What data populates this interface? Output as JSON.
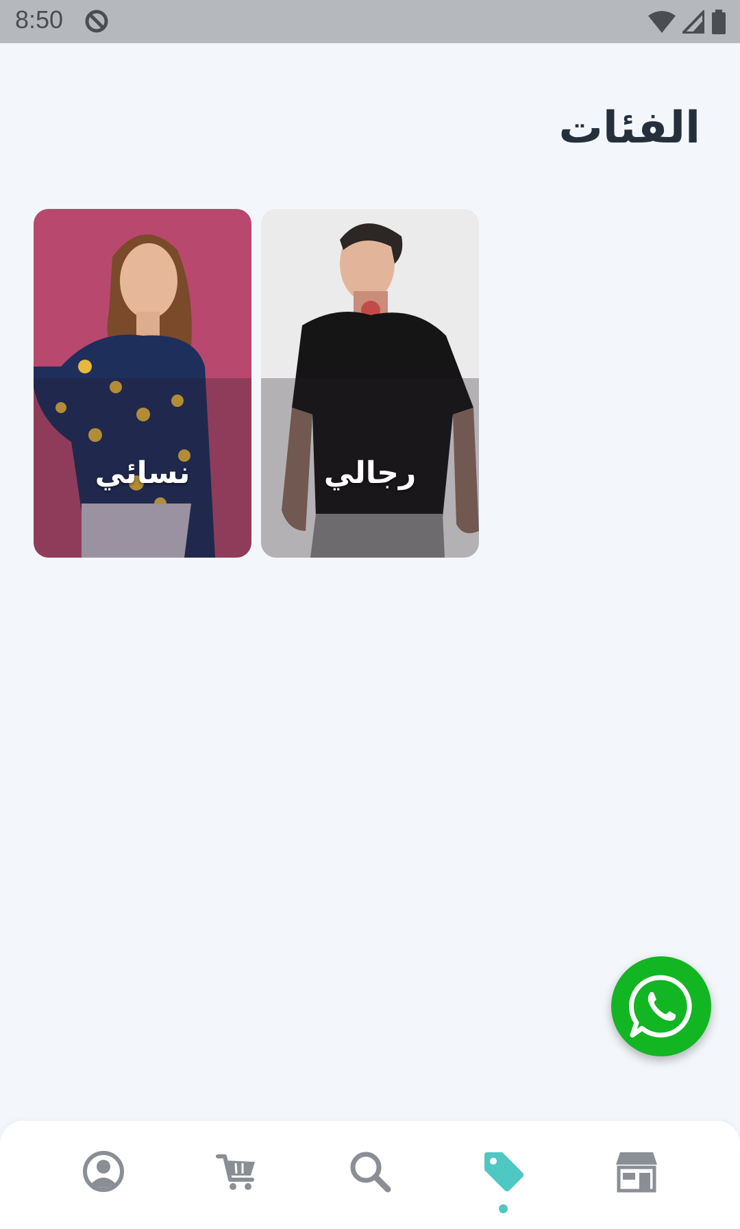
{
  "status_bar": {
    "time": "8:50",
    "icons": [
      "sync-off-icon",
      "wifi-icon",
      "signal-icon",
      "battery-icon"
    ]
  },
  "page": {
    "title": "الفئات"
  },
  "categories": [
    {
      "label": "نسائي",
      "image": "woman-in-floral-blouse-photo",
      "background": "#b8486e"
    },
    {
      "label": "رجالي",
      "image": "man-in-black-tshirt-photo",
      "background": "#ebebec"
    }
  ],
  "whatsapp_button": {
    "icon": "whatsapp-icon",
    "color": "#12b522"
  },
  "bottom_nav": {
    "items": [
      {
        "icon": "profile-icon",
        "active": false
      },
      {
        "icon": "cart-icon",
        "active": false
      },
      {
        "icon": "search-icon",
        "active": false
      },
      {
        "icon": "tag-icon",
        "active": true
      },
      {
        "icon": "store-icon",
        "active": false
      }
    ],
    "active_color": "#4fc7c2",
    "inactive_color": "#8a8f96"
  }
}
